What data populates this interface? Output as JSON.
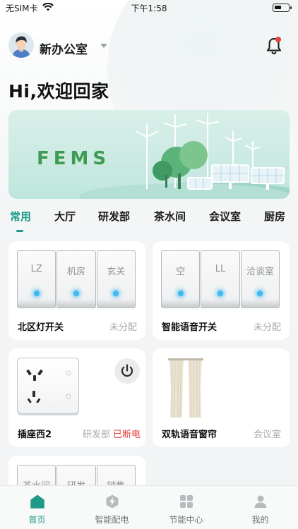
{
  "status_bar": {
    "carrier": "无SIM卡",
    "time": "下午1:58"
  },
  "header": {
    "office": "新办公室",
    "greeting": "Hi,欢迎回家"
  },
  "banner": {
    "text": "FEMS"
  },
  "tabs": [
    {
      "label": "常用",
      "active": true
    },
    {
      "label": "大厅"
    },
    {
      "label": "研发部"
    },
    {
      "label": "茶水间"
    },
    {
      "label": "会议室"
    },
    {
      "label": "厨房"
    }
  ],
  "devices": [
    {
      "name": "北区灯开关",
      "status": "未分配",
      "keys": [
        "LZ",
        "机房",
        "玄关"
      ]
    },
    {
      "name": "智能语音开关",
      "status": "未分配",
      "keys": [
        "空",
        "LL",
        "洽谈室"
      ]
    },
    {
      "name": "插座西2",
      "room": "研发部",
      "status": "已断电"
    },
    {
      "name": "双轨语音窗帘",
      "status": "会议室"
    },
    {
      "keys": [
        "茶水间",
        "研发",
        "销售"
      ]
    }
  ],
  "bottom_nav": [
    {
      "label": "首页",
      "icon": "home-icon",
      "active": true
    },
    {
      "label": "智能配电",
      "icon": "power-distribution-icon"
    },
    {
      "label": "节能中心",
      "icon": "grid-apps-icon"
    },
    {
      "label": "我的",
      "icon": "user-icon"
    }
  ],
  "colors": {
    "accent": "#1f9a89",
    "alert": "#e3423e",
    "led": "#3fb9f0"
  }
}
